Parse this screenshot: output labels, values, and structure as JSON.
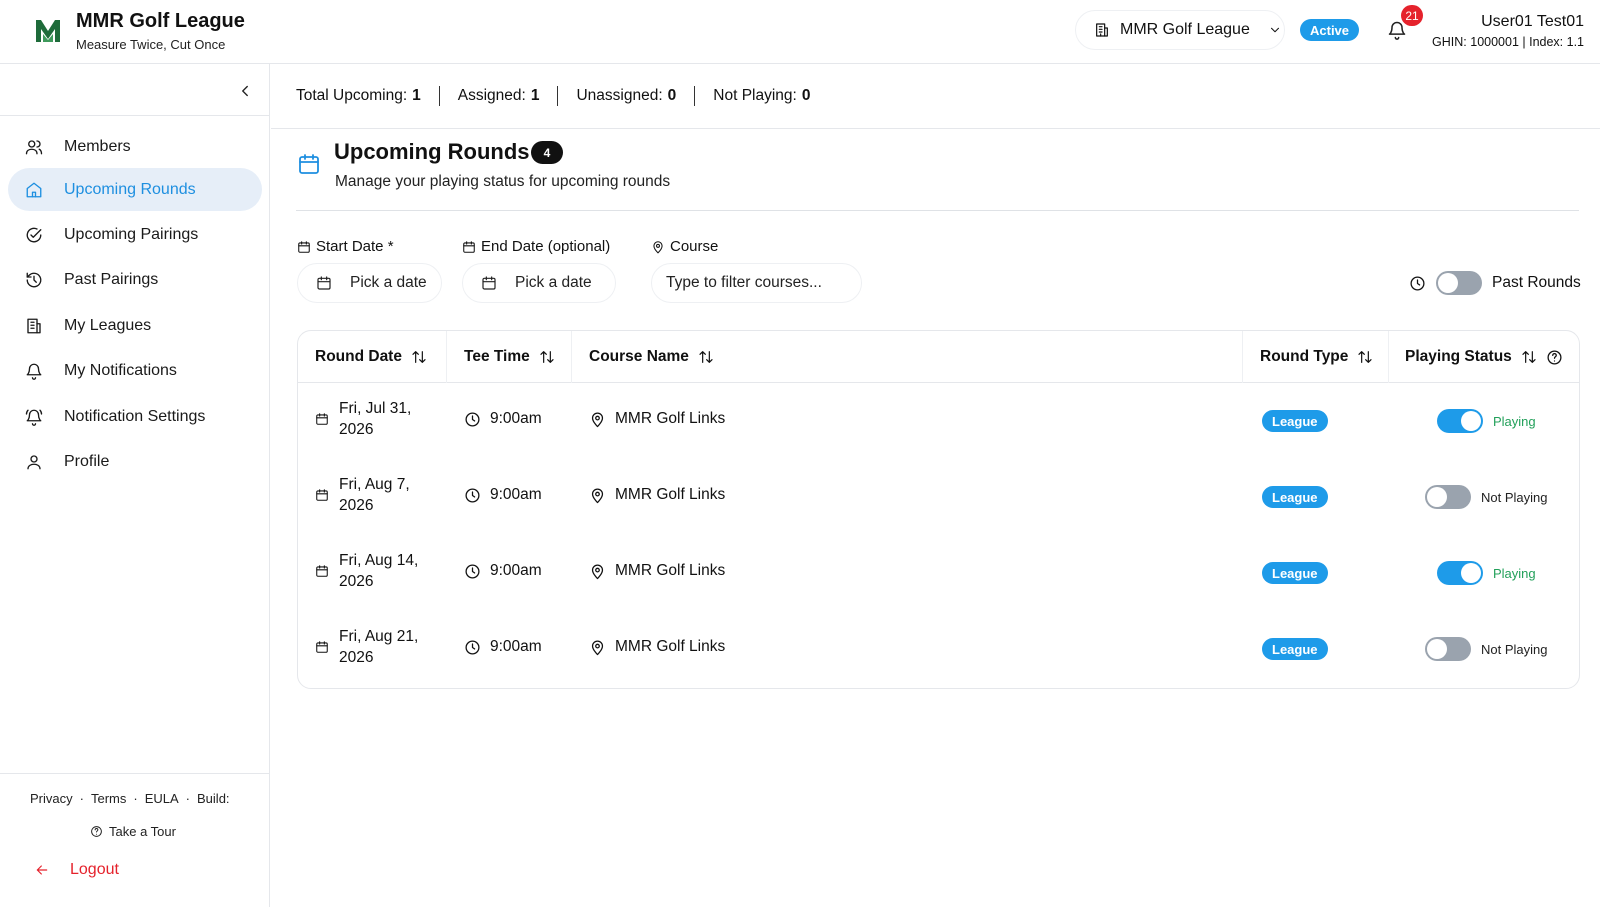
{
  "header": {
    "title": "MMR Golf League",
    "subtitle": "Measure Twice, Cut Once",
    "league_select": "MMR Golf League",
    "status_badge": "Active",
    "notification_count": "21",
    "user_name": "User01 Test01",
    "user_meta": "GHIN: 1000001 | Index: 1.1",
    "brand_color": "#1e6b3a"
  },
  "sidebar": {
    "items": [
      {
        "label": "Members",
        "icon": "users-icon"
      },
      {
        "label": "Upcoming Rounds",
        "icon": "home-icon",
        "active": true
      },
      {
        "label": "Upcoming Pairings",
        "icon": "check-circle-icon"
      },
      {
        "label": "Past Pairings",
        "icon": "history-icon"
      },
      {
        "label": "My Leagues",
        "icon": "building-icon"
      },
      {
        "label": "My Notifications",
        "icon": "bell-icon"
      },
      {
        "label": "Notification Settings",
        "icon": "bell-ring-icon"
      },
      {
        "label": "Profile",
        "icon": "user-icon"
      }
    ],
    "footer_links": [
      "Privacy",
      "·",
      "Terms",
      "·",
      "EULA",
      "·",
      "Build:"
    ],
    "tour": "Take a Tour",
    "logout": "Logout"
  },
  "stats": {
    "total_label": "Total Upcoming:",
    "total": "1",
    "assigned_label": "Assigned:",
    "assigned": "1",
    "unassigned_label": "Unassigned:",
    "unassigned": "0",
    "not_playing_label": "Not Playing:",
    "not_playing": "0"
  },
  "page": {
    "title": "Upcoming Rounds",
    "count": "4",
    "subtitle": "Manage your playing status for upcoming rounds"
  },
  "filters": {
    "start_label": "Start Date *",
    "start_placeholder": "Pick a date",
    "end_label": "End Date (optional)",
    "end_placeholder": "Pick a date",
    "course_label": "Course",
    "course_placeholder": "Type to filter courses...",
    "past_rounds_label": "Past Rounds",
    "past_rounds_on": false
  },
  "table": {
    "columns": [
      "Round Date",
      "Tee Time",
      "Course Name",
      "Round Type",
      "Playing Status"
    ],
    "rows": [
      {
        "date_line1": "Fri, Jul 31,",
        "date_line2": "2026",
        "time": "9:00am",
        "course": "MMR Golf Links",
        "type": "League",
        "playing": true,
        "status": "Playing"
      },
      {
        "date_line1": "Fri, Aug 7,",
        "date_line2": "2026",
        "time": "9:00am",
        "course": "MMR Golf Links",
        "type": "League",
        "playing": false,
        "status": "Not Playing"
      },
      {
        "date_line1": "Fri, Aug 14,",
        "date_line2": "2026",
        "time": "9:00am",
        "course": "MMR Golf Links",
        "type": "League",
        "playing": true,
        "status": "Playing"
      },
      {
        "date_line1": "Fri, Aug 21,",
        "date_line2": "2026",
        "time": "9:00am",
        "course": "MMR Golf Links",
        "type": "League",
        "playing": false,
        "status": "Not Playing"
      }
    ]
  },
  "colors": {
    "accent": "#1e9be9",
    "active_nav_bg": "#e6eef8",
    "playing_text": "#22a05a",
    "danger": "#e5222c"
  }
}
